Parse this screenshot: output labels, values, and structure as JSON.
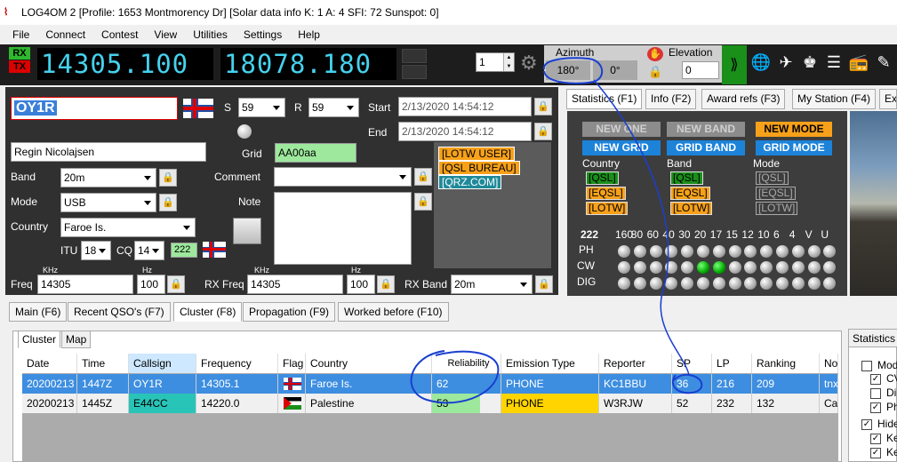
{
  "window": {
    "title": "LOG4OM 2 [Profile: 1653 Montmorency Dr] [Solar data info K: 1 A: 4 SFI: 72 Sunspot: 0]"
  },
  "menu": [
    "File",
    "Connect",
    "Contest",
    "View",
    "Utilities",
    "Settings",
    "Help"
  ],
  "radio": {
    "rx": "RX",
    "tx": "TX",
    "freq1": "14305.100",
    "freq2": "18078.180",
    "stepper": "1"
  },
  "azimuth": {
    "label": "Azimuth",
    "short_path": "180°",
    "long_path": "0°"
  },
  "elevation": {
    "label": "Elevation",
    "value": "0"
  },
  "qso": {
    "callsign": "OY1R",
    "s_label": "S",
    "s_value": "59",
    "r_label": "R",
    "r_value": "59",
    "start_label": "Start",
    "start_value": "2/13/2020 14:54:12",
    "end_label": "End",
    "end_value": "2/13/2020 14:54:12",
    "name": "Regin Nicolajsen",
    "grid_label": "Grid",
    "grid_value": "AA00aa",
    "band_label": "Band",
    "band_value": "20m",
    "comment_label": "Comment",
    "mode_label": "Mode",
    "mode_value": "USB",
    "note_label": "Note",
    "country_label": "Country",
    "country_value": "Faroe Is.",
    "itu_label": "ITU",
    "itu_value": "18",
    "cq_label": "CQ",
    "cq_value": "14",
    "dxcc_value": "222",
    "khz1": "KHz",
    "hz1": "Hz",
    "khz2": "KHz",
    "hz2": "Hz",
    "freq_label": "Freq",
    "freq_value": "14305",
    "freq_hz": "100",
    "rxfreq_label": "RX Freq",
    "rxfreq_value": "14305",
    "rxfreq_hz": "100",
    "rxband_label": "RX Band",
    "rxband_value": "20m"
  },
  "qsl_tags": [
    "[LOTW USER]",
    "[QSL BUREAU]",
    "[QRZ.COM]"
  ],
  "bottom_tabs": [
    "Main (F6)",
    "Recent QSO's (F7)",
    "Cluster (F8)",
    "Propagation (F9)",
    "Worked before (F10)"
  ],
  "right_tabs": [
    "Statistics (F1)",
    "Info (F2)",
    "Award refs (F3)",
    "My Station (F4)",
    "Ex"
  ],
  "stats": {
    "new_one": "NEW ONE",
    "new_band": "NEW BAND",
    "new_mode": "NEW MODE",
    "new_grid": "NEW GRID",
    "grid_band": "GRID BAND",
    "grid_mode": "GRID MODE",
    "country_label": "Country",
    "band_label": "Band",
    "mode_label": "Mode",
    "qsl": "[QSL]",
    "eqsl": "[EQSL]",
    "lotw": "[LOTW]",
    "dxcc": "222",
    "bands": [
      "160",
      "80",
      "60",
      "40",
      "30",
      "20",
      "17",
      "15",
      "12",
      "10",
      "6",
      "4",
      "V",
      "U"
    ],
    "rows": [
      "PH",
      "CW",
      "DIG"
    ]
  },
  "cluster": {
    "tabs": [
      "Cluster",
      "Map"
    ],
    "columns": [
      "Date",
      "Time",
      "Callsign",
      "Frequency",
      "Flag",
      "Country",
      "Reliability",
      "Emission Type",
      "Reporter",
      "SP",
      "LP",
      "Ranking",
      "No"
    ],
    "rows": [
      {
        "date": "20200213",
        "time": "1447Z",
        "call": "OY1R",
        "freq": "14305.1",
        "country": "Faroe Is.",
        "rel": "62",
        "emission": "PHONE",
        "reporter": "KC1BBU",
        "sp": "36",
        "lp": "216",
        "rank": "209",
        "note": "tnx"
      },
      {
        "date": "20200213",
        "time": "1445Z",
        "call": "E44CC",
        "freq": "14220.0",
        "country": "Palestine",
        "rel": "53",
        "emission": "PHONE",
        "reporter": "W3RJW",
        "sp": "52",
        "lp": "232",
        "rank": "132",
        "note": "Can"
      }
    ]
  },
  "side_stats": {
    "title": "Statistics",
    "items": [
      "Mod",
      "CV",
      "Di",
      "Ph",
      "Hide",
      "Ke",
      "Ke"
    ]
  }
}
